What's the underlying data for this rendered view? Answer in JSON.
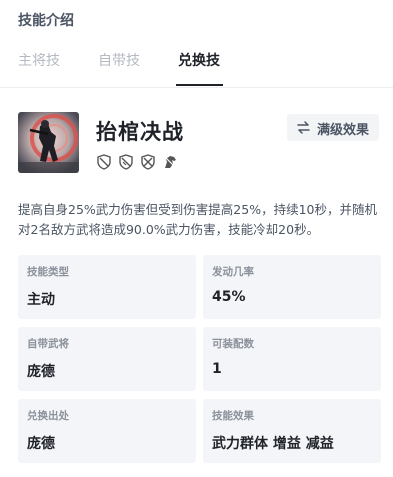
{
  "header": {
    "title": "技能介绍"
  },
  "tabs": [
    {
      "label": "主将技",
      "active": false
    },
    {
      "label": "自带技",
      "active": false
    },
    {
      "label": "兑换技",
      "active": true
    }
  ],
  "skill": {
    "name": "抬棺决战",
    "icon": "warrior-portrait-image",
    "tag_icons": [
      "shield-slash-icon",
      "shield-slash-icon",
      "shield-cross-icon",
      "horse-icon"
    ],
    "max_button": {
      "icon": "swap-arrows-icon",
      "label": "满级效果"
    },
    "description": "提高自身25%武力伤害但受到伤害提高25%，持续10秒，并随机对2名敌方武将造成90.0%武力伤害，技能冷却20秒。"
  },
  "info_cards": [
    {
      "key": "技能类型",
      "value": "主动"
    },
    {
      "key": "发动几率",
      "value": "45%"
    },
    {
      "key": "自带武将",
      "value": "庞德"
    },
    {
      "key": "可装配数",
      "value": "1"
    },
    {
      "key": "兑换出处",
      "value": "庞德"
    },
    {
      "key": "技能效果",
      "value": "武力群体 增益 减益"
    }
  ],
  "colors": {
    "text": "#1f2329",
    "muted": "#b4b9c1",
    "card_bg": "#f4f5f8",
    "accent_red": "#d9534f"
  }
}
